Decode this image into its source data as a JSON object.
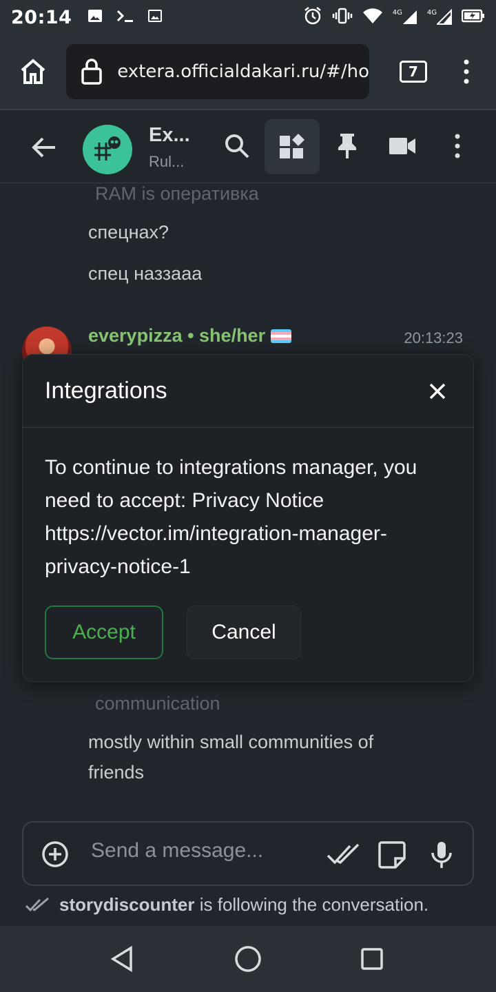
{
  "status_bar": {
    "time": "20:14",
    "network_label": "4G",
    "network_label_2": "4G"
  },
  "browser": {
    "url": "extera.officialdakari.ru/#/ho",
    "tab_count": "7"
  },
  "room": {
    "name": "Ex...",
    "topic": "Rul..."
  },
  "timeline": {
    "messages_top": [
      {
        "text": "RAM is оперативка",
        "faded": true
      },
      {
        "text": "спецнах?"
      },
      {
        "text": "спец наззааа"
      }
    ],
    "sender_name": "everypizza • she/her",
    "sender_time": "20:13:23",
    "messages_bottom": [
      {
        "text": "communication",
        "faded": true
      },
      {
        "text": "mostly within small communities of"
      },
      {
        "text": "friends"
      }
    ]
  },
  "dialog": {
    "title": "Integrations",
    "body": "To continue to integrations manager, you need to accept: Privacy Notice https://vector.im/integration-manager-privacy-notice-1",
    "accept_label": "Accept",
    "cancel_label": "Cancel"
  },
  "composer": {
    "placeholder": "Send a message..."
  },
  "typing": {
    "user": "storydiscounter",
    "text": " is following the conversation."
  }
}
